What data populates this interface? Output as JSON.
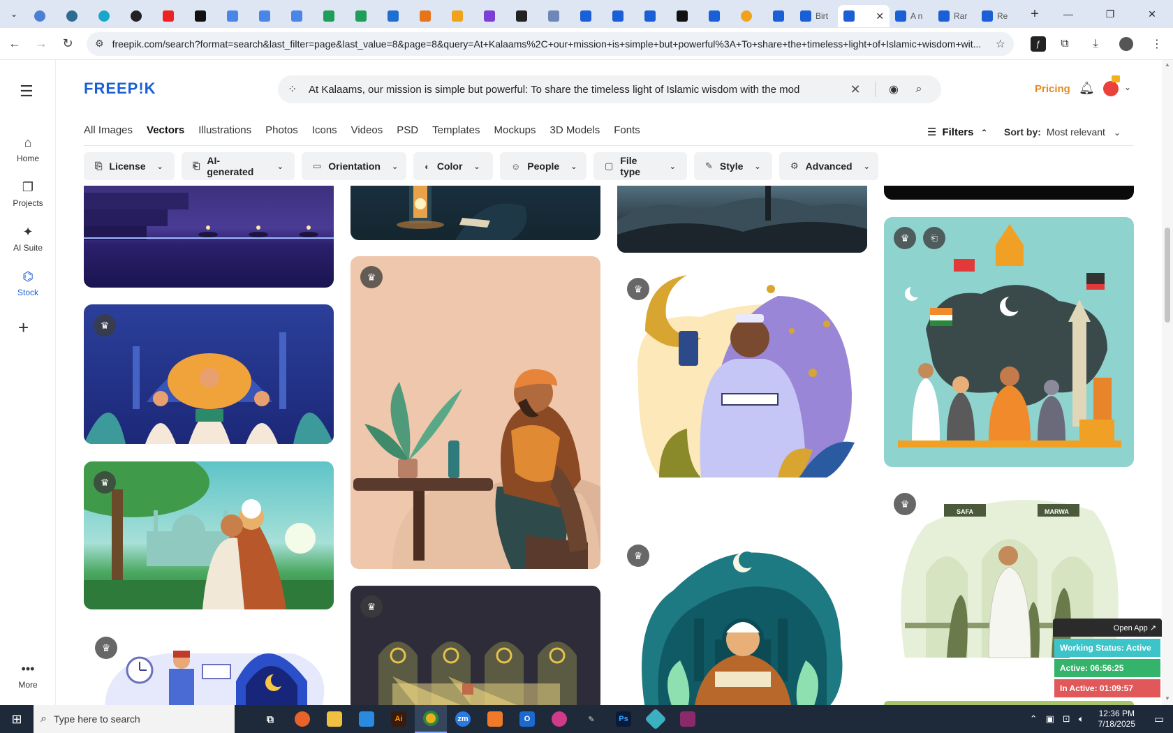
{
  "browser": {
    "tabs_active_label": "",
    "doc_tabs": [
      "Birt",
      "A n",
      "Rar",
      "Re"
    ],
    "url": "freepik.com/search?format=search&last_filter=page&last_value=8&page=8&query=At+Kalaams%2C+our+mission+is+simple+but+powerful%3A+To+share+the+timeless+light+of+Islamic+wisdom+wit..."
  },
  "rail": {
    "items": [
      {
        "label": "Home",
        "icon": "home-icon"
      },
      {
        "label": "Projects",
        "icon": "projects-icon"
      },
      {
        "label": "AI Suite",
        "icon": "sparkle-icon"
      },
      {
        "label": "Stock",
        "icon": "stock-icon"
      },
      {
        "label": "More",
        "icon": "more-icon"
      }
    ]
  },
  "header": {
    "logo": "FREEP!K",
    "search_value": "At Kalaams, our mission is simple but powerful: To share the timeless light of Islamic wisdom with the mod",
    "pricing": "Pricing"
  },
  "categories": [
    "All Images",
    "Vectors",
    "Illustrations",
    "Photos",
    "Icons",
    "Videos",
    "PSD",
    "Templates",
    "Mockups",
    "3D Models",
    "Fonts"
  ],
  "active_category": "Vectors",
  "filters_label": "Filters",
  "sort": {
    "label": "Sort by:",
    "value": "Most relevant"
  },
  "chips": [
    "License",
    "AI-generated",
    "Orientation",
    "Color",
    "People",
    "File type",
    "Style",
    "Advanced"
  ],
  "image_labels": {
    "safa": "SAFA",
    "marwa": "MARWA"
  },
  "status_widget": {
    "open_app": "Open App ↗",
    "working": "Working Status: Active",
    "active": "Active: 06:56:25",
    "inactive": "In Active: 01:09:57"
  },
  "taskbar": {
    "search_placeholder": "Type here to search",
    "time": "12:36 PM",
    "date": "7/18/2025"
  },
  "colors": {
    "brand": "#1a5fd6",
    "pricing": "#e8891f"
  }
}
